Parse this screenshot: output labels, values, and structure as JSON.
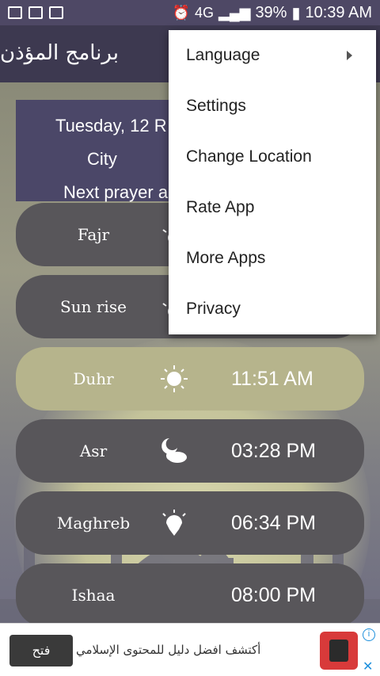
{
  "status_bar": {
    "network": "4G",
    "battery": "39%",
    "time": "10:39 AM"
  },
  "app_bar": {
    "title": "برنامج المؤذن"
  },
  "info": {
    "date": "Tuesday, 12 R",
    "city": "City",
    "next_prayer": "Next prayer a"
  },
  "prayers": [
    {
      "name": "Fajr",
      "time": "",
      "icon": "sunrise-icon"
    },
    {
      "name": "Sun rise",
      "time": "",
      "icon": "sunrise-icon"
    },
    {
      "name": "Duhr",
      "time": "11:51 AM",
      "icon": "sun-icon"
    },
    {
      "name": "Asr",
      "time": "03:28 PM",
      "icon": "sun-cloud-icon"
    },
    {
      "name": "Maghreb",
      "time": "06:34 PM",
      "icon": "sunset-icon"
    },
    {
      "name": "Ishaa",
      "time": "08:00 PM",
      "icon": "moon-icon"
    }
  ],
  "menu": {
    "items": [
      "Language",
      "Settings",
      "Change Location",
      "Rate App",
      "More Apps",
      "Privacy"
    ]
  },
  "ad": {
    "button": "فتح",
    "text": "أكتشف افضل دليل للمحتوى الإسلامي"
  },
  "colors": {
    "app_bar": "#3d3950",
    "active_row": "#b6b48c",
    "row": "#58565a"
  }
}
